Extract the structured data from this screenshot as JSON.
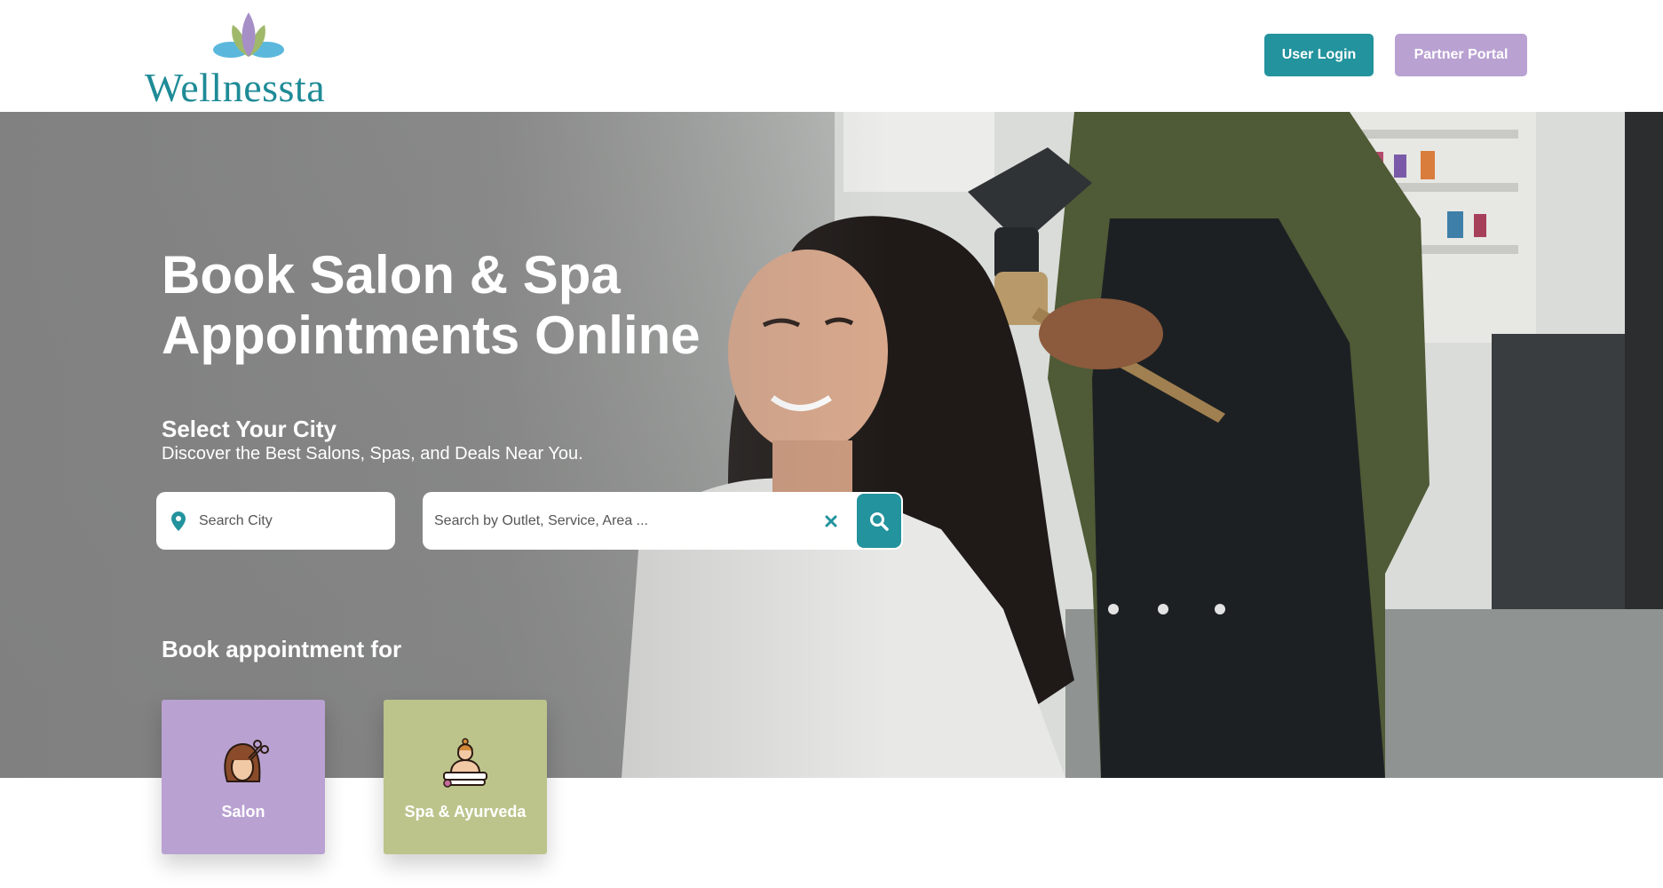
{
  "brand": {
    "name": "Wellnessta",
    "color": "#1e8b96"
  },
  "header": {
    "user_login": "User Login",
    "partner_portal": "Partner Portal"
  },
  "hero": {
    "title_line1": "Book Salon & Spa",
    "title_line2": "Appointments Online",
    "city_heading": "Select Your City",
    "city_subheading": "Discover the Best Salons, Spas, and Deals Near You.",
    "book_heading": "Book appointment for"
  },
  "search": {
    "city_placeholder": "Search City",
    "outlet_placeholder": "Search by Outlet, Service, Area ..."
  },
  "categories": [
    {
      "label": "Salon",
      "icon": "salon-icon",
      "color": "#b9a1d2"
    },
    {
      "label": "Spa & Ayurveda",
      "icon": "spa-icon",
      "color": "#bcc48b"
    }
  ],
  "colors": {
    "accent": "#23939d",
    "secondary": "#b9a1d2"
  }
}
